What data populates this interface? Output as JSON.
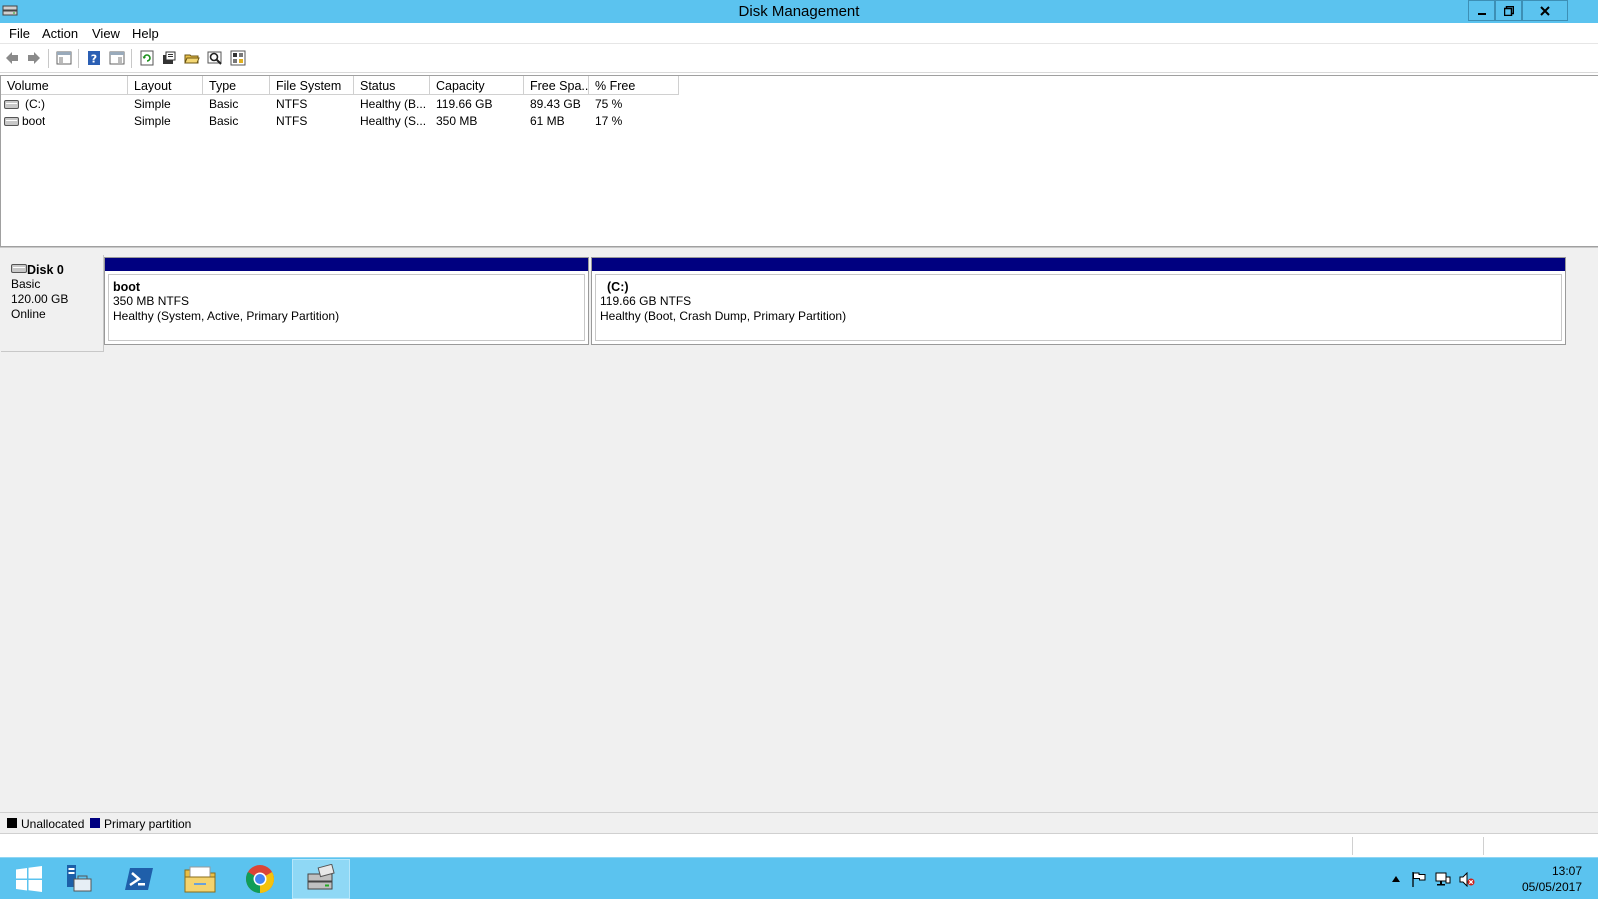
{
  "window": {
    "title": "Disk Management"
  },
  "menu": [
    {
      "label": "File"
    },
    {
      "label": "Action"
    },
    {
      "label": "View"
    },
    {
      "label": "Help"
    }
  ],
  "toolbar": {
    "icons": [
      "back-arrow-icon",
      "forward-arrow-icon",
      "show-hide-console-tree-icon",
      "help-icon",
      "show-hide-action-pane-icon",
      "refresh-icon",
      "properties-icon",
      "open-folder-icon",
      "rescan-disks-icon",
      "settings-icon"
    ]
  },
  "volume_table": {
    "columns": [
      "Volume",
      "Layout",
      "Type",
      "File System",
      "Status",
      "Capacity",
      "Free Spa...",
      "% Free"
    ],
    "rows": [
      {
        "volume": "(C:)",
        "layout": "Simple",
        "type": "Basic",
        "fs": "NTFS",
        "status": "Healthy (B...",
        "capacity": "119.66 GB",
        "free": "89.43 GB",
        "pct": "75 %"
      },
      {
        "volume": "boot",
        "layout": "Simple",
        "type": "Basic",
        "fs": "NTFS",
        "status": "Healthy (S...",
        "capacity": "350 MB",
        "free": "61 MB",
        "pct": "17 %"
      }
    ]
  },
  "disk": {
    "name": "Disk 0",
    "type": "Basic",
    "size": "120.00 GB",
    "state": "Online",
    "partitions": [
      {
        "name": "boot",
        "size": "350 MB NTFS",
        "status": "Healthy (System, Active, Primary Partition)"
      },
      {
        "name": "(C:)",
        "size": "119.66 GB NTFS",
        "status": "Healthy (Boot, Crash Dump, Primary Partition)"
      }
    ]
  },
  "legend": [
    {
      "label": "Unallocated",
      "color": "#000000"
    },
    {
      "label": "Primary partition",
      "color": "#000080"
    }
  ],
  "colors": {
    "primary_partition": "#000080",
    "unallocated": "#000000",
    "titlebar": "#5bc3ef"
  },
  "taskbar": {
    "apps": [
      "start-button",
      "server-manager-app",
      "powershell-app",
      "file-explorer-app",
      "chrome-app",
      "disk-management-app"
    ],
    "clock": {
      "time": "13:07",
      "date": "05/05/2017"
    }
  }
}
